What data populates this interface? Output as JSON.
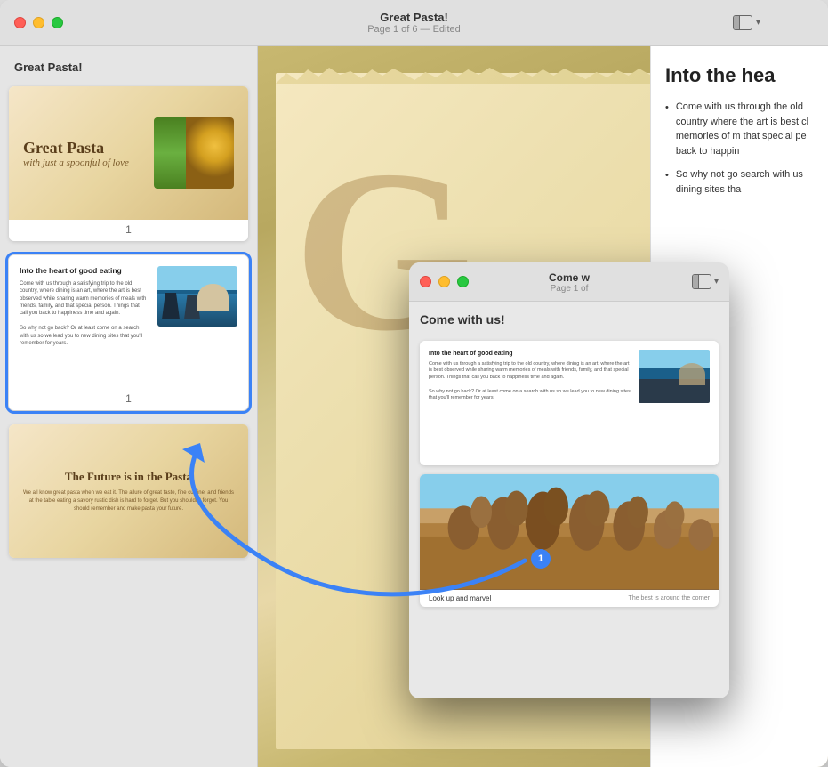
{
  "mainWindow": {
    "title": "Great Pasta!",
    "subtitle": "Page 1 of 6 — Edited",
    "sidebarTitle": "Great Pasta!",
    "slides": [
      {
        "id": 1,
        "title": "Great Pasta",
        "subtitle": "with just a spoonful of love",
        "number": "1",
        "type": "title"
      },
      {
        "id": 2,
        "title": "Into the heart of good eating",
        "body": "Come with us through a satisfying trip to the old country, where dining is an art, where the art is best observed while sharing warm memories of meals with friends, family, and that special person. Things that call you back to happiness time and again.\n\nSo why not go back? Or at least come on a search with us so we lead you to new dining sites that you'll remember for years.",
        "number": "1",
        "type": "venice"
      },
      {
        "id": 3,
        "title": "The Future is in the Pasta",
        "body": "We all know great pasta when we eat it. The allure of great taste, fine cuisine, and friends at the table eating a savory rustic dish is hard to forget. But you shouldn't forget. You should remember and make pasta your future.",
        "type": "future"
      }
    ]
  },
  "rightPanel": {
    "title": "Into the hea",
    "bullets": [
      "Come with us through the old country where dining is art is best cl memories of m that special pe back to happin",
      "So why not go search with us dining sites tha"
    ]
  },
  "secondWindow": {
    "title": "Come w",
    "subtitle": "Page 1 of",
    "sidebarTitle": "Come with us!",
    "badge": "1",
    "slide": {
      "title": "Into the heart of good eating",
      "body": "Come with us through a satisfying trip to the old country, where dining is an art, where the art is best observed while sharing warm memories of meals with friends, family, and that special person. Things that call you back to happiness time and again.\n\nSo why not go back? Or at least come on a search with us so we lead you to new dining sites that you'll remember for years.",
      "type": "venice"
    },
    "colosseumSlide": {
      "caption": "Look up and marvel",
      "subcaption": "The best is around the corner"
    }
  },
  "icons": {
    "sidebarToggle": "⊞",
    "chevronDown": "▾",
    "bulletPoint": "•"
  }
}
